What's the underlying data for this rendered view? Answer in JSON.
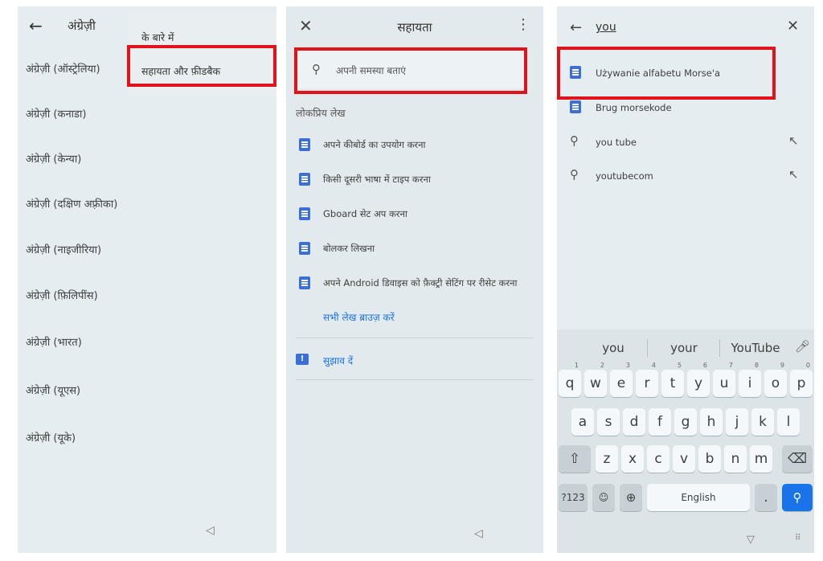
{
  "screen1": {
    "back_icon": "arrow-left",
    "title": "अंग्रेज़ी",
    "menu": [
      "के बारे में",
      "सहायता और फ़ीडबैक"
    ],
    "languages": [
      "अंग्रेज़ी (ऑस्ट्रेलिया)",
      "अंग्रेज़ी (कनाडा)",
      "अंग्रेज़ी (केन्या)",
      "अंग्रेज़ी (दक्षिण अफ़्रीका)",
      "अंग्रेज़ी (नाइजीरिया)",
      "अंग्रेज़ी (फ़िलिपींस)",
      "अंग्रेज़ी (भारत)",
      "अंग्रेज़ी (यूएस)",
      "अंग्रेज़ी (यूके)"
    ]
  },
  "screen2": {
    "title": "सहायता",
    "search_placeholder": "अपनी समस्या बताएं",
    "section_title": "लोकप्रिय लेख",
    "articles": [
      "अपने कीबोर्ड का उपयोग करना",
      "किसी दूसरी भाषा में टाइप करना",
      "Gboard सेट अप करना",
      "बोलकर लिखना",
      "अपने Android डिवाइस को फ़ैक्ट्री सेटिंग पर रीसेट करना"
    ],
    "browse_all": "सभी लेख ब्राउज़ करें",
    "feedback": "सुझाव दें"
  },
  "screen3": {
    "query": "you",
    "results": [
      {
        "type": "article",
        "label": "Używanie alfabetu Morse'a"
      },
      {
        "type": "article",
        "label": "Brug morsekode"
      },
      {
        "type": "search",
        "label": "you tube"
      },
      {
        "type": "search",
        "label": "youtubecom"
      }
    ],
    "keyboard": {
      "predictions": [
        "you",
        "your",
        "YouTube"
      ],
      "row1": [
        {
          "k": "q",
          "h": "1"
        },
        {
          "k": "w",
          "h": "2"
        },
        {
          "k": "e",
          "h": "3"
        },
        {
          "k": "r",
          "h": "4"
        },
        {
          "k": "t",
          "h": "5"
        },
        {
          "k": "y",
          "h": "6"
        },
        {
          "k": "u",
          "h": "7"
        },
        {
          "k": "i",
          "h": "8"
        },
        {
          "k": "o",
          "h": "9"
        },
        {
          "k": "p",
          "h": "0"
        }
      ],
      "row2": [
        "a",
        "s",
        "d",
        "f",
        "g",
        "h",
        "j",
        "k",
        "l"
      ],
      "row3": [
        "z",
        "x",
        "c",
        "v",
        "b",
        "n",
        "m"
      ],
      "symbols_key": "?123",
      "space_label": "English",
      "period_key": "."
    }
  },
  "colors": {
    "highlight": "#e0131b",
    "accent": "#1a73e8",
    "doc_icon": "#3b6fd6"
  }
}
